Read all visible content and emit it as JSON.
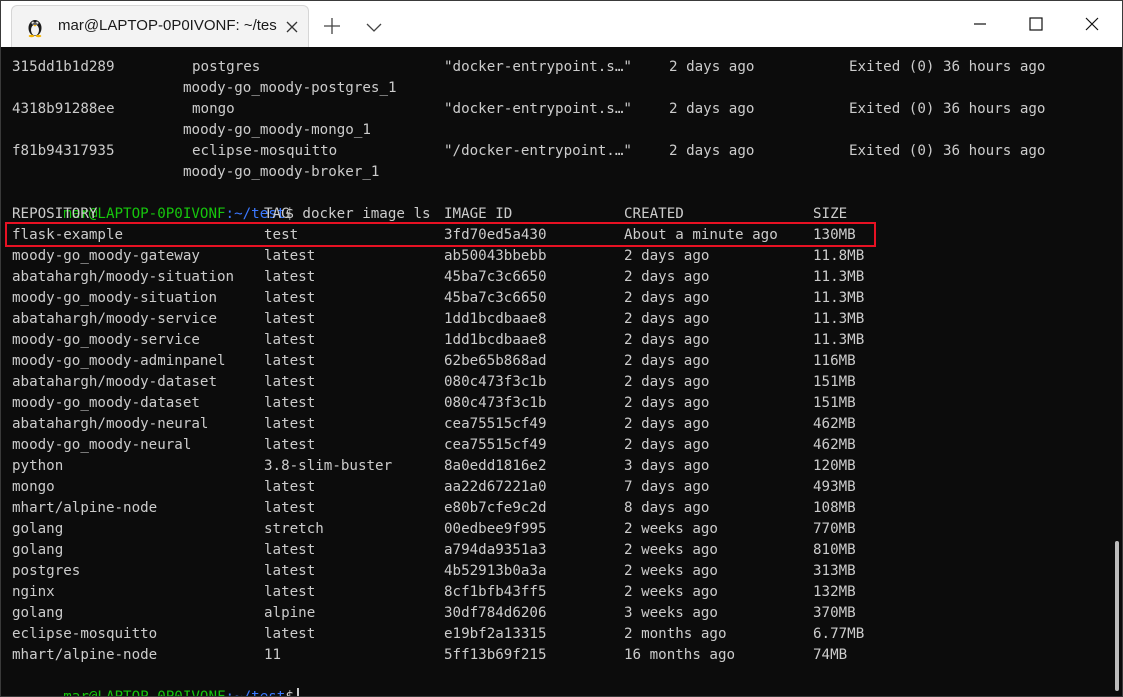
{
  "window": {
    "tab_title": "mar@LAPTOP-0P0IVONF: ~/tes",
    "tab_icon": "linux-tux-icon",
    "new_tab_icon": "plus-icon",
    "dropdown_icon": "chevron-down-icon"
  },
  "terminal": {
    "containers": [
      {
        "id": "315dd1b1d289",
        "image": "postgres",
        "command": "\"docker-entrypoint.s…\"",
        "created": "2 days ago",
        "status": "Exited (0) 36 hours ago",
        "name": "moody-go_moody-postgres_1"
      },
      {
        "id": "4318b91288ee",
        "image": "mongo",
        "command": "\"docker-entrypoint.s…\"",
        "created": "2 days ago",
        "status": "Exited (0) 36 hours ago",
        "name": "moody-go_moody-mongo_1"
      },
      {
        "id": "f81b94317935",
        "image": "eclipse-mosquitto",
        "command": "\"/docker-entrypoint.…\"",
        "created": "2 days ago",
        "status": "Exited (0) 36 hours ago",
        "name": "moody-go_moody-broker_1"
      }
    ],
    "prompt_user": "mar@LAPTOP-0P0IVONF",
    "prompt_path": ":~/test",
    "prompt_symbol": "$",
    "command": " docker image ls",
    "headers": {
      "repository": "REPOSITORY",
      "tag": "TAG",
      "image_id": "IMAGE ID",
      "created": "CREATED",
      "size": "SIZE"
    },
    "images": [
      {
        "repository": "flask-example",
        "tag": "test",
        "image_id": "3fd70ed5a430",
        "created": "About a minute ago",
        "size": "130MB"
      },
      {
        "repository": "moody-go_moody-gateway",
        "tag": "latest",
        "image_id": "ab50043bbebb",
        "created": "2 days ago",
        "size": "11.8MB"
      },
      {
        "repository": "abatahargh/moody-situation",
        "tag": "latest",
        "image_id": "45ba7c3c6650",
        "created": "2 days ago",
        "size": "11.3MB"
      },
      {
        "repository": "moody-go_moody-situation",
        "tag": "latest",
        "image_id": "45ba7c3c6650",
        "created": "2 days ago",
        "size": "11.3MB"
      },
      {
        "repository": "abatahargh/moody-service",
        "tag": "latest",
        "image_id": "1dd1bcdbaae8",
        "created": "2 days ago",
        "size": "11.3MB"
      },
      {
        "repository": "moody-go_moody-service",
        "tag": "latest",
        "image_id": "1dd1bcdbaae8",
        "created": "2 days ago",
        "size": "11.3MB"
      },
      {
        "repository": "moody-go_moody-adminpanel",
        "tag": "latest",
        "image_id": "62be65b868ad",
        "created": "2 days ago",
        "size": "116MB"
      },
      {
        "repository": "abatahargh/moody-dataset",
        "tag": "latest",
        "image_id": "080c473f3c1b",
        "created": "2 days ago",
        "size": "151MB"
      },
      {
        "repository": "moody-go_moody-dataset",
        "tag": "latest",
        "image_id": "080c473f3c1b",
        "created": "2 days ago",
        "size": "151MB"
      },
      {
        "repository": "abatahargh/moody-neural",
        "tag": "latest",
        "image_id": "cea75515cf49",
        "created": "2 days ago",
        "size": "462MB"
      },
      {
        "repository": "moody-go_moody-neural",
        "tag": "latest",
        "image_id": "cea75515cf49",
        "created": "2 days ago",
        "size": "462MB"
      },
      {
        "repository": "python",
        "tag": "3.8-slim-buster",
        "image_id": "8a0edd1816e2",
        "created": "3 days ago",
        "size": "120MB"
      },
      {
        "repository": "mongo",
        "tag": "latest",
        "image_id": "aa22d67221a0",
        "created": "7 days ago",
        "size": "493MB"
      },
      {
        "repository": "mhart/alpine-node",
        "tag": "latest",
        "image_id": "e80b7cfe9c2d",
        "created": "8 days ago",
        "size": "108MB"
      },
      {
        "repository": "golang",
        "tag": "stretch",
        "image_id": "00edbee9f995",
        "created": "2 weeks ago",
        "size": "770MB"
      },
      {
        "repository": "golang",
        "tag": "latest",
        "image_id": "a794da9351a3",
        "created": "2 weeks ago",
        "size": "810MB"
      },
      {
        "repository": "postgres",
        "tag": "latest",
        "image_id": "4b52913b0a3a",
        "created": "2 weeks ago",
        "size": "313MB"
      },
      {
        "repository": "nginx",
        "tag": "latest",
        "image_id": "8cf1bfb43ff5",
        "created": "2 weeks ago",
        "size": "132MB"
      },
      {
        "repository": "golang",
        "tag": "alpine",
        "image_id": "30df784d6206",
        "created": "3 weeks ago",
        "size": "370MB"
      },
      {
        "repository": "eclipse-mosquitto",
        "tag": "latest",
        "image_id": "e19bf2a13315",
        "created": "2 months ago",
        "size": "6.77MB"
      },
      {
        "repository": "mhart/alpine-node",
        "tag": "11",
        "image_id": "5ff13b69f215",
        "created": "16 months ago",
        "size": "74MB"
      }
    ],
    "highlight_color": "#e81123",
    "user_color": "#16c60c",
    "path_color": "#3b78ff"
  }
}
